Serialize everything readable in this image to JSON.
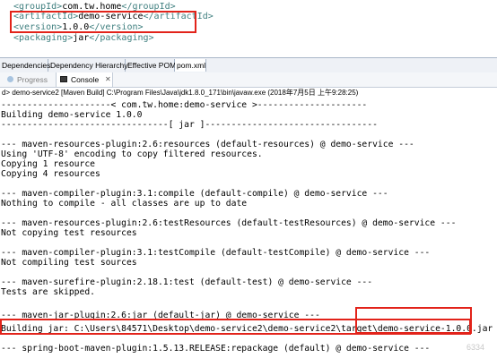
{
  "xml_editor": {
    "lines": [
      {
        "open": "<groupId>",
        "value": "com.tw.home",
        "close": "</groupId>"
      },
      {
        "open": "<artifactId>",
        "value": "demo-service",
        "close": "</artifactId>"
      },
      {
        "open": "<version>",
        "value": "1.0.0",
        "close": "</version>"
      },
      {
        "open": "<packaging>",
        "value": "jar",
        "close": "</packaging>"
      }
    ]
  },
  "pom_tabs": [
    "Dependencies",
    "Dependency Hierarchy",
    "Effective POM",
    "pom.xml"
  ],
  "view_tabs": {
    "progress": "Progress",
    "console": "Console",
    "close_symbol": "✕"
  },
  "launch_info": "d> demo-service2 [Maven Build] C:\\Program Files\\Java\\jdk1.8.0_171\\bin\\javaw.exe (2018年7月5日 上午9:28:25)",
  "console_lines": [
    "---------------------< com.tw.home:demo-service >---------------------",
    "Building demo-service 1.0.0",
    "--------------------------------[ jar ]---------------------------------",
    "",
    "--- maven-resources-plugin:2.6:resources (default-resources) @ demo-service ---",
    "Using 'UTF-8' encoding to copy filtered resources.",
    "Copying 1 resource",
    "Copying 4 resources",
    "",
    "--- maven-compiler-plugin:3.1:compile (default-compile) @ demo-service ---",
    "Nothing to compile - all classes are up to date",
    "",
    "--- maven-resources-plugin:2.6:testResources (default-testResources) @ demo-service ---",
    "Not copying test resources",
    "",
    "--- maven-compiler-plugin:3.1:testCompile (default-testCompile) @ demo-service ---",
    "Not compiling test sources",
    "",
    "--- maven-surefire-plugin:2.18.1:test (default-test) @ demo-service ---",
    "Tests are skipped.",
    "",
    "--- maven-jar-plugin:2.6:jar (default-jar) @ demo-service ---",
    "Building jar: C:\\Users\\84571\\Desktop\\demo-service2\\demo-service2\\target\\demo-service-1.0.0.jar",
    "",
    "--- spring-boot-maven-plugin:1.5.13.RELEASE:repackage (default) @ demo-service ---"
  ],
  "watermark": "6334",
  "colors": {
    "xml_tag": "#3f7f7f",
    "highlight_box": "#e2231a",
    "tab_bar": "#eef1f6"
  }
}
